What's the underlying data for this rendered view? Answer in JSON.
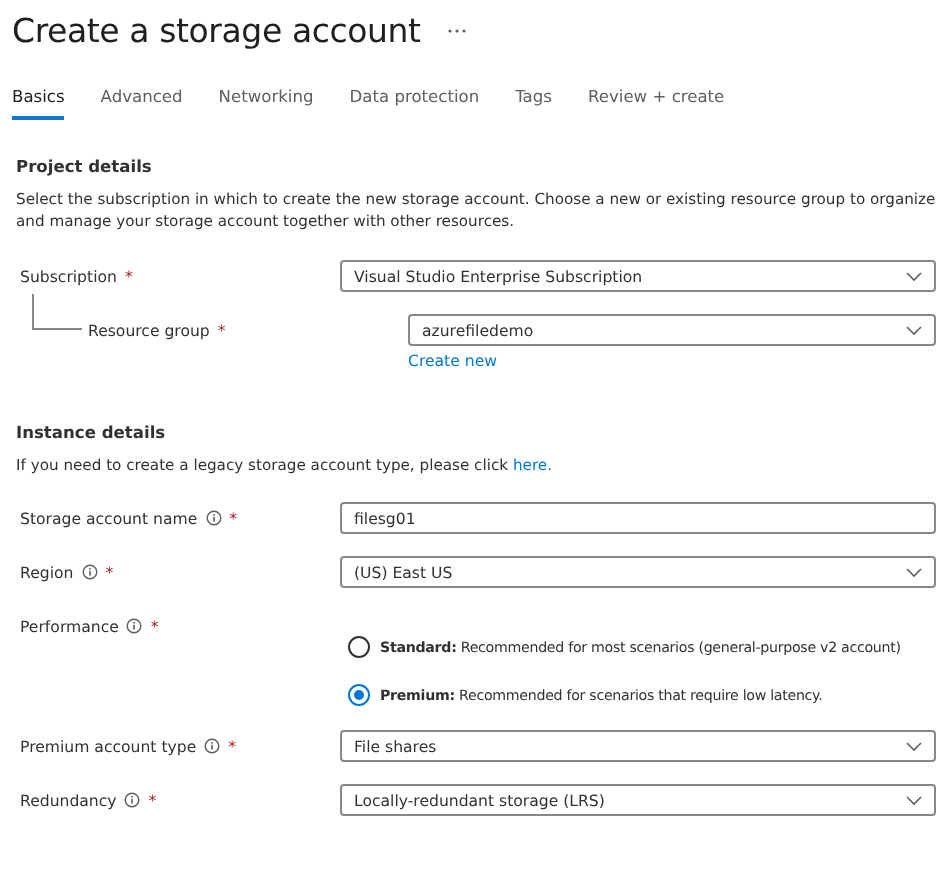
{
  "title": "Create a storage account",
  "tabs": [
    {
      "label": "Basics",
      "selected": true
    },
    {
      "label": "Advanced",
      "selected": false
    },
    {
      "label": "Networking",
      "selected": false
    },
    {
      "label": "Data protection",
      "selected": false
    },
    {
      "label": "Tags",
      "selected": false
    },
    {
      "label": "Review + create",
      "selected": false
    }
  ],
  "project": {
    "heading": "Project details",
    "description": "Select the subscription in which to create the new storage account. Choose a new or existing resource group to organize and manage your storage account together with other resources.",
    "fields": [
      {
        "kind": "select",
        "label": "Subscription",
        "required_mark": "*",
        "info": false,
        "nested": false,
        "value": "Visual Studio Enterprise Subscription"
      },
      {
        "kind": "select",
        "label": "Resource group",
        "required_mark": "*",
        "info": false,
        "nested": true,
        "value": "azurefiledemo",
        "link": "Create new"
      }
    ]
  },
  "instance": {
    "heading": "Instance details",
    "description": "If you need to create a legacy storage account type, please click ",
    "description_link": "here.",
    "fields": [
      {
        "kind": "text",
        "label": "Storage account name",
        "required_mark": "*",
        "info": true,
        "nested": false,
        "value": "filesg01"
      },
      {
        "kind": "select",
        "label": "Region",
        "required_mark": "*",
        "info": true,
        "nested": false,
        "value": "(US) East US"
      },
      {
        "kind": "radio",
        "label": "Performance",
        "required_mark": "*",
        "info": true,
        "nested": false,
        "options": [
          {
            "text": "**Standard:** Recommended for most scenarios (general-purpose v2 account)",
            "selected": false
          },
          {
            "text": "**Premium:** Recommended for scenarios that require low latency.",
            "selected": true
          }
        ]
      },
      {
        "kind": "select",
        "label": "Premium account type",
        "required_mark": "*",
        "info": true,
        "nested": false,
        "value": "File shares"
      },
      {
        "kind": "select",
        "label": "Redundancy",
        "required_mark": "*",
        "info": true,
        "nested": false,
        "value": "Locally-redundant storage (LRS)"
      }
    ]
  }
}
